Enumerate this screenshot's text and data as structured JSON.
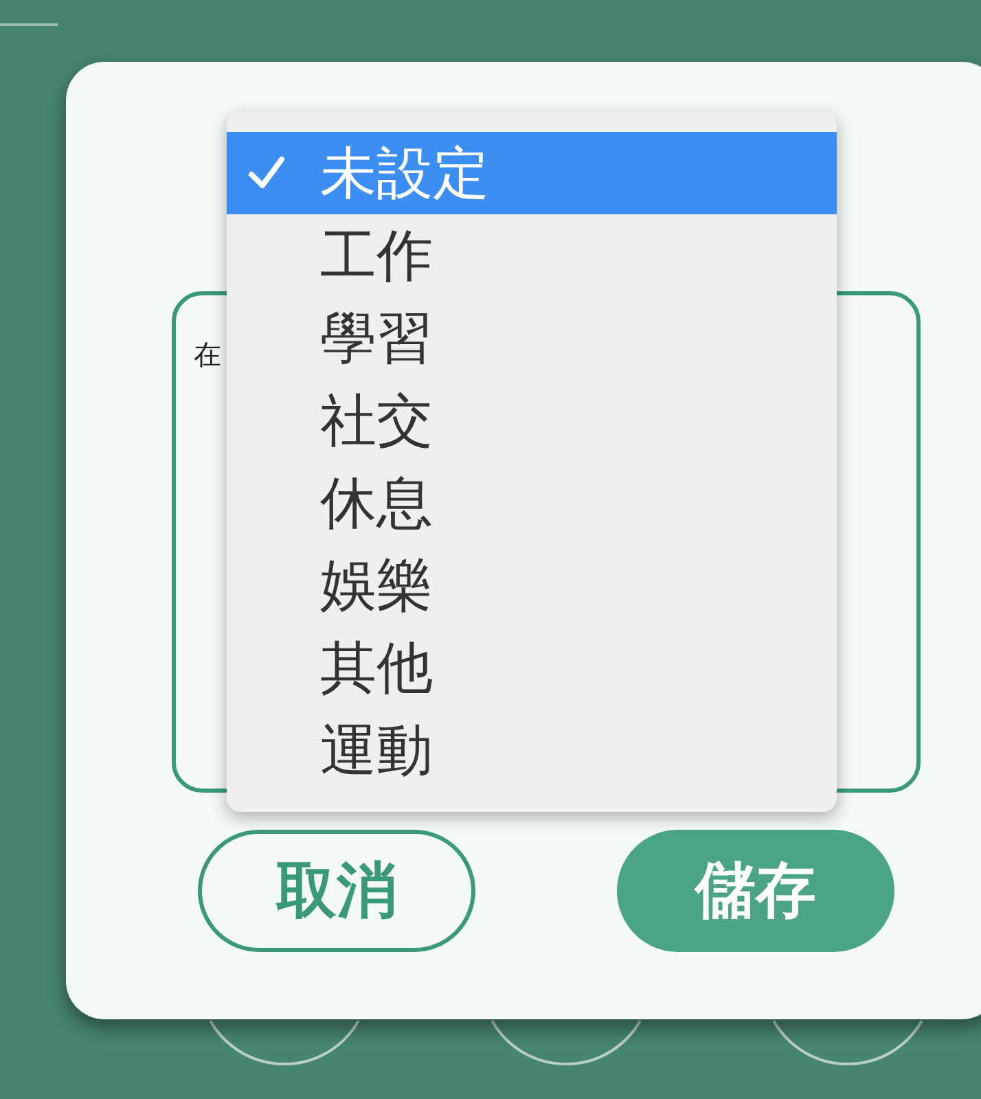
{
  "text_area": {
    "value": "在"
  },
  "dropdown": {
    "options": [
      {
        "label": "未設定",
        "selected": true
      },
      {
        "label": "工作",
        "selected": false
      },
      {
        "label": "學習",
        "selected": false
      },
      {
        "label": "社交",
        "selected": false
      },
      {
        "label": "休息",
        "selected": false
      },
      {
        "label": "娛樂",
        "selected": false
      },
      {
        "label": "其他",
        "selected": false
      },
      {
        "label": "運動",
        "selected": false
      }
    ]
  },
  "buttons": [
    {
      "label": "取消",
      "kind": "outline"
    },
    {
      "label": "儲存",
      "kind": "filled"
    }
  ]
}
